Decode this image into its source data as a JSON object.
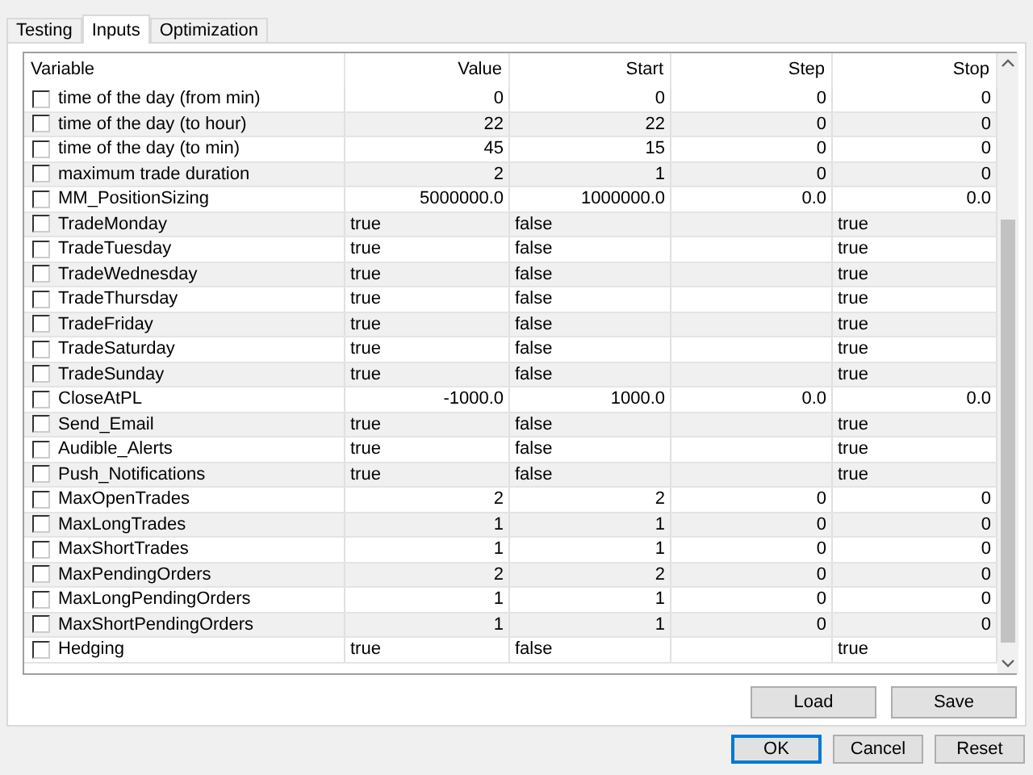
{
  "tabs": [
    {
      "label": "Testing",
      "selected": false
    },
    {
      "label": "Inputs",
      "selected": true
    },
    {
      "label": "Optimization",
      "selected": false
    }
  ],
  "table": {
    "columns": [
      "Variable",
      "Value",
      "Start",
      "Step",
      "Stop"
    ],
    "rows": [
      {
        "kind": "number",
        "checked": false,
        "variable": "time of the day (from min)",
        "value": "0",
        "start": "0",
        "step": "0",
        "stop": "0"
      },
      {
        "kind": "number",
        "checked": false,
        "variable": "time of the day (to hour)",
        "value": "22",
        "start": "22",
        "step": "0",
        "stop": "0"
      },
      {
        "kind": "number",
        "checked": false,
        "variable": "time of the day (to min)",
        "value": "45",
        "start": "15",
        "step": "0",
        "stop": "0"
      },
      {
        "kind": "number",
        "checked": false,
        "variable": "maximum trade duration",
        "value": "2",
        "start": "1",
        "step": "0",
        "stop": "0"
      },
      {
        "kind": "number",
        "checked": false,
        "variable": "MM_PositionSizing",
        "value": "5000000.0",
        "start": "1000000.0",
        "step": "0.0",
        "stop": "0.0"
      },
      {
        "kind": "bool",
        "checked": false,
        "variable": "TradeMonday",
        "value": "true",
        "start": "false",
        "stop": "true"
      },
      {
        "kind": "bool",
        "checked": false,
        "variable": "TradeTuesday",
        "value": "true",
        "start": "false",
        "stop": "true"
      },
      {
        "kind": "bool",
        "checked": false,
        "variable": "TradeWednesday",
        "value": "true",
        "start": "false",
        "stop": "true"
      },
      {
        "kind": "bool",
        "checked": false,
        "variable": "TradeThursday",
        "value": "true",
        "start": "false",
        "stop": "true"
      },
      {
        "kind": "bool",
        "checked": false,
        "variable": "TradeFriday",
        "value": "true",
        "start": "false",
        "stop": "true"
      },
      {
        "kind": "bool",
        "checked": false,
        "variable": "TradeSaturday",
        "value": "true",
        "start": "false",
        "stop": "true"
      },
      {
        "kind": "bool",
        "checked": false,
        "variable": "TradeSunday",
        "value": "true",
        "start": "false",
        "stop": "true"
      },
      {
        "kind": "number",
        "checked": false,
        "variable": "CloseAtPL",
        "value": "-1000.0",
        "start": "1000.0",
        "step": "0.0",
        "stop": "0.0"
      },
      {
        "kind": "bool",
        "checked": false,
        "variable": "Send_Email",
        "value": "true",
        "start": "false",
        "stop": "true"
      },
      {
        "kind": "bool",
        "checked": false,
        "variable": "Audible_Alerts",
        "value": "true",
        "start": "false",
        "stop": "true"
      },
      {
        "kind": "bool",
        "checked": false,
        "variable": "Push_Notifications",
        "value": "true",
        "start": "false",
        "stop": "true"
      },
      {
        "kind": "number",
        "checked": false,
        "variable": "MaxOpenTrades",
        "value": "2",
        "start": "2",
        "step": "0",
        "stop": "0"
      },
      {
        "kind": "number",
        "checked": false,
        "variable": "MaxLongTrades",
        "value": "1",
        "start": "1",
        "step": "0",
        "stop": "0"
      },
      {
        "kind": "number",
        "checked": false,
        "variable": "MaxShortTrades",
        "value": "1",
        "start": "1",
        "step": "0",
        "stop": "0"
      },
      {
        "kind": "number",
        "checked": false,
        "variable": "MaxPendingOrders",
        "value": "2",
        "start": "2",
        "step": "0",
        "stop": "0"
      },
      {
        "kind": "number",
        "checked": false,
        "variable": "MaxLongPendingOrders",
        "value": "1",
        "start": "1",
        "step": "0",
        "stop": "0"
      },
      {
        "kind": "number",
        "checked": false,
        "variable": "MaxShortPendingOrders",
        "value": "1",
        "start": "1",
        "step": "0",
        "stop": "0"
      },
      {
        "kind": "bool",
        "checked": false,
        "variable": "Hedging",
        "value": "true",
        "start": "false",
        "stop": "true"
      }
    ]
  },
  "panel_buttons": [
    "Load",
    "Save"
  ],
  "dialog_buttons": [
    {
      "label": "OK",
      "default": true
    },
    {
      "label": "Cancel",
      "default": false
    },
    {
      "label": "Reset",
      "default": false
    }
  ]
}
